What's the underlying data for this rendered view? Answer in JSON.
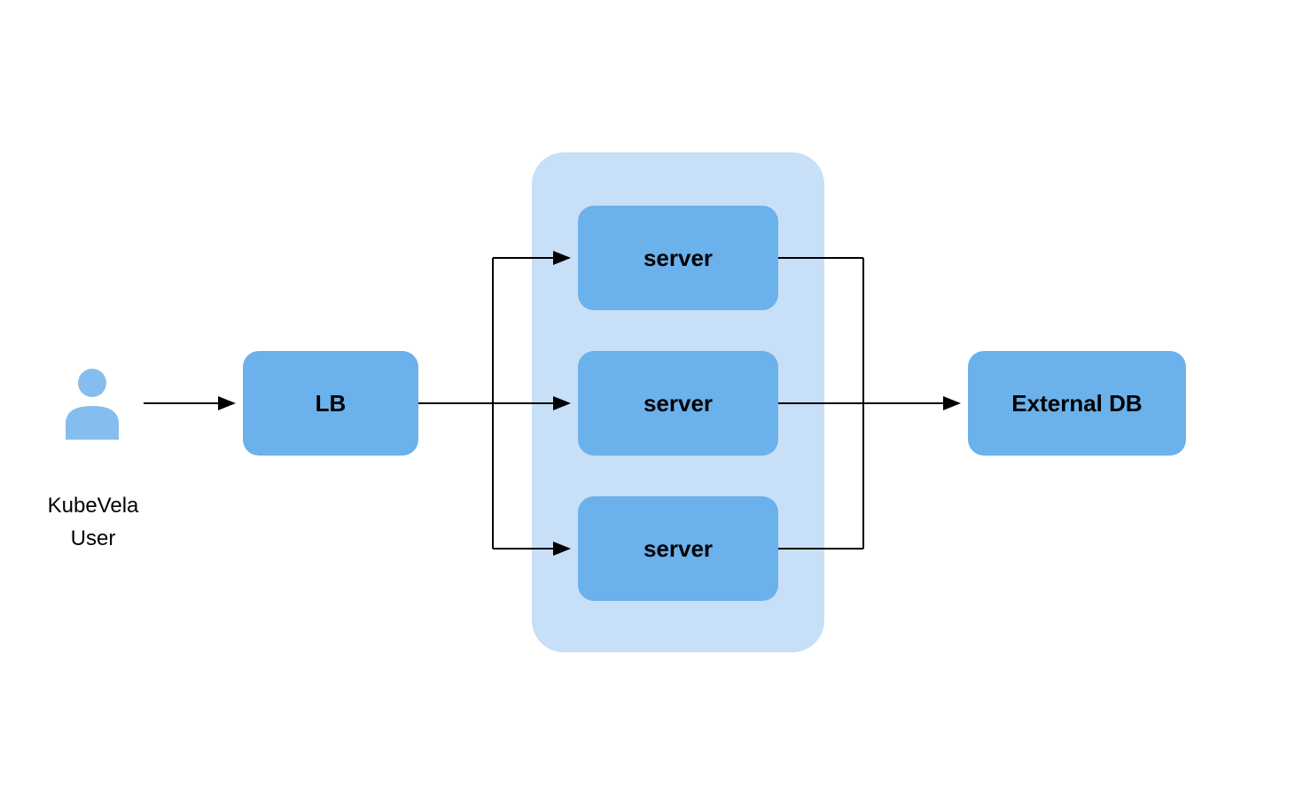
{
  "user": {
    "label": "KubeVela\nUser"
  },
  "lb": {
    "label": "LB"
  },
  "group": {
    "servers": [
      {
        "label": "server"
      },
      {
        "label": "server"
      },
      {
        "label": "server"
      }
    ]
  },
  "db": {
    "label": "External DB"
  },
  "colors": {
    "node": "#6bb1eb",
    "group_bg": "#c7dff7",
    "user_icon": "#85bdee",
    "arrow": "#000000"
  }
}
